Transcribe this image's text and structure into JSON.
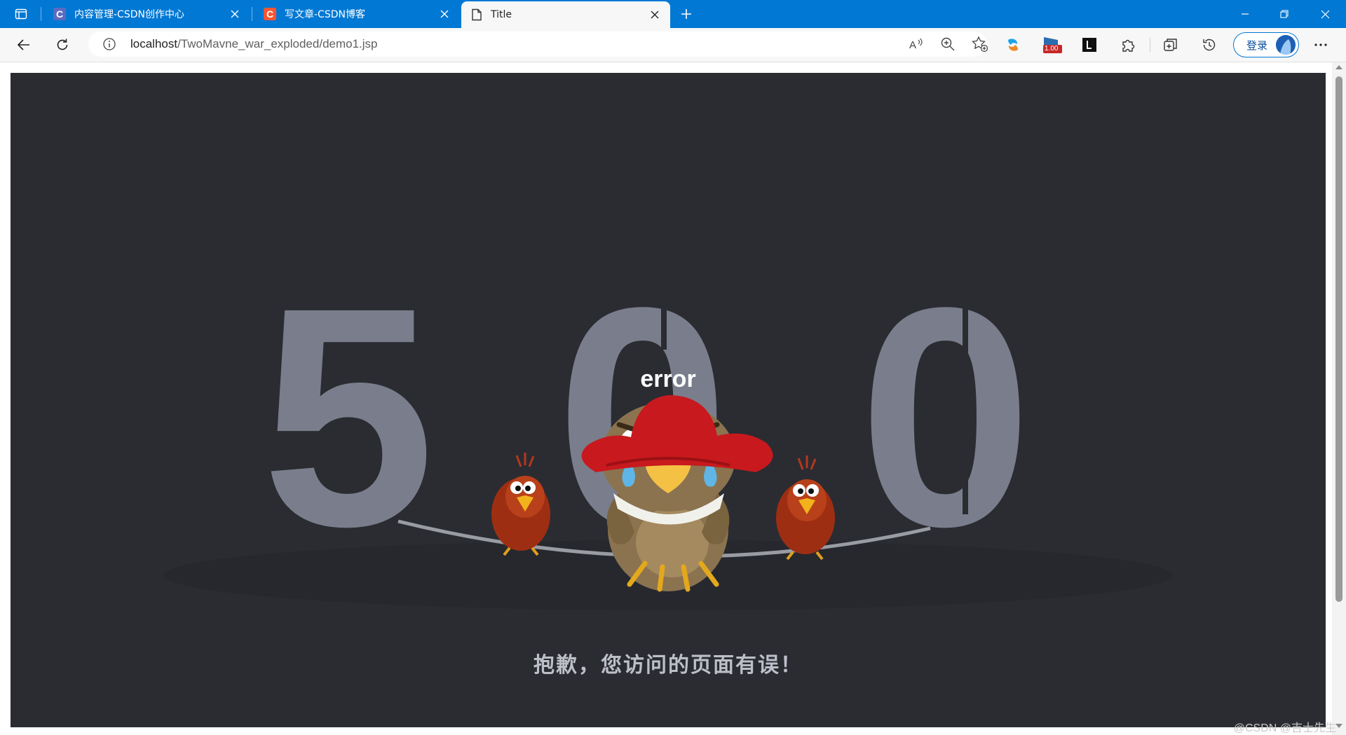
{
  "tabs": [
    {
      "title": "内容管理-CSDN创作中心",
      "favicon": "csdn-c-icon",
      "favicon_color": "#5c6bc0",
      "favicon_letter": "C",
      "active": false
    },
    {
      "title": "写文章-CSDN博客",
      "favicon": "csdn-c-icon",
      "favicon_color": "#fc5531",
      "favicon_letter": "C",
      "active": false
    },
    {
      "title": "Title",
      "favicon": "page-icon",
      "active": true
    }
  ],
  "address_bar": {
    "host": "localhost",
    "path": "/TwoMavne_war_exploded/demo1.jsp"
  },
  "toolbar": {
    "login_label": "登录",
    "badge_value": "1.00"
  },
  "page": {
    "error_code_digits": [
      "5",
      "0",
      "0"
    ],
    "hat_text": "error",
    "apology_text": "抱歉，您访问的页面有误！"
  },
  "watermark": "@CSDN @吉士先生",
  "colors": {
    "titlebar": "#0078d4",
    "page_background": "#2a2c32",
    "digit_color": "#7a7e8c",
    "hat_red": "#c8191e",
    "apology_text": "#bcbfc8"
  }
}
